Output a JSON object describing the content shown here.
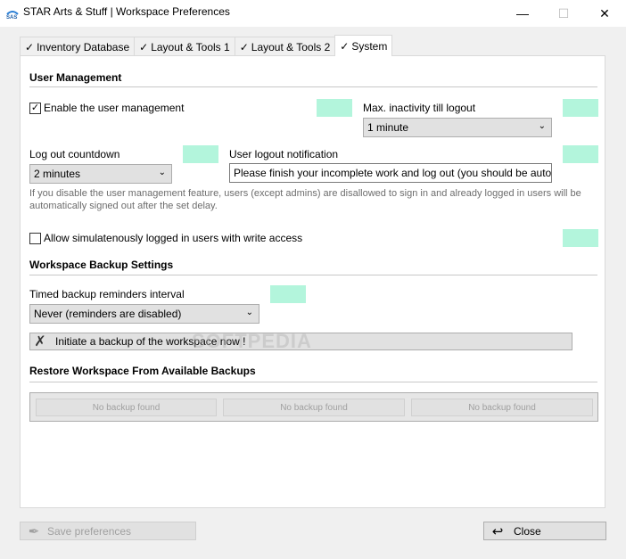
{
  "window": {
    "title": "STAR Arts & Stuff | Workspace Preferences",
    "minimize_glyph": "—",
    "maximize_glyph": "☐",
    "close_glyph": "✕"
  },
  "tabs": [
    {
      "label": "Inventory Database",
      "check": "✓"
    },
    {
      "label": "Layout & Tools 1",
      "check": "✓"
    },
    {
      "label": "Layout & Tools 2",
      "check": "✓"
    },
    {
      "label": "System",
      "check": "✓"
    }
  ],
  "user_management": {
    "title": "User Management",
    "enable_label": "Enable the user management",
    "enable_checked": true,
    "max_inactivity_label": "Max. inactivity till logout",
    "max_inactivity_value": "1 minute",
    "logout_countdown_label": "Log out countdown",
    "logout_countdown_value": "2 minutes",
    "logout_notification_label": "User logout notification",
    "logout_notification_value": "Please finish your incomplete work and log out (you should be automatically logged out)",
    "note": "If you disable the user management feature, users (except admins) are disallowed to sign in and already logged in users will be automatically signed out after the set delay.",
    "simultaneous_label": "Allow simulatenously logged in users with write access",
    "simultaneous_checked": false
  },
  "backup": {
    "title": "Workspace Backup Settings",
    "interval_label": "Timed backup reminders interval",
    "interval_value": "Never (reminders are disabled)",
    "initiate_label": "Initiate a backup of the workspace now !"
  },
  "restore": {
    "title": "Restore Workspace From Available Backups",
    "slots": [
      "No backup found",
      "No backup found",
      "No backup found"
    ]
  },
  "footer": {
    "save_label": "Save preferences",
    "close_label": "Close"
  },
  "watermark": "SOFTPEDIA",
  "colors": {
    "swatch": "#b3f5dc"
  },
  "icons": {
    "app": "sas-logo-icon",
    "initiate": "pencil-cross-icon",
    "save": "pen-icon",
    "close": "return-arrow-icon"
  }
}
